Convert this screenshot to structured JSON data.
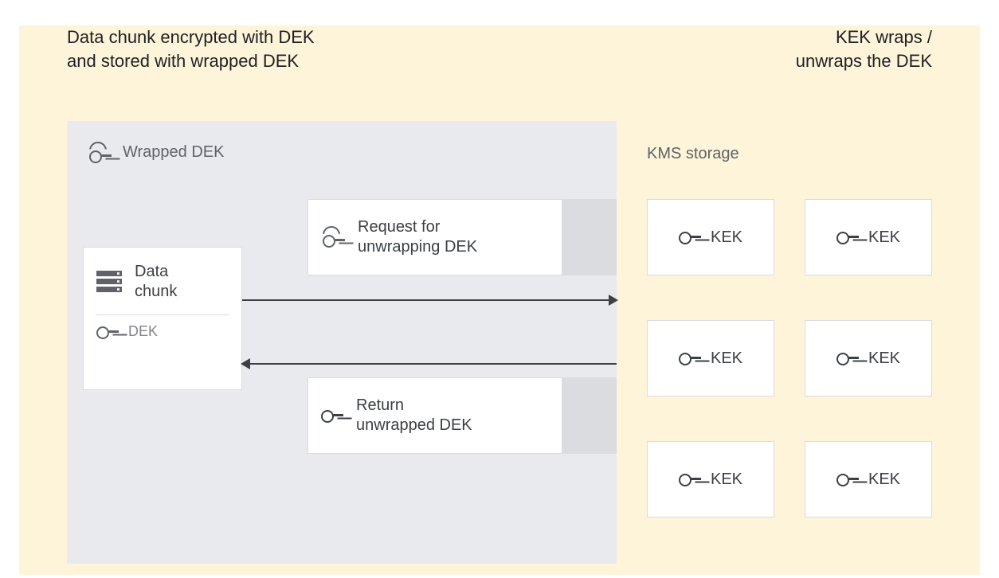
{
  "header": {
    "left_line1": "Data chunk encrypted with DEK",
    "left_line2": "and stored with wrapped DEK",
    "right_line1": "KEK wraps /",
    "right_line2": "unwraps the DEK"
  },
  "left_panel": {
    "title": "Wrapped DEK",
    "data_chunk_label": "Data\nchunk",
    "dek_label": "DEK"
  },
  "messages": {
    "request": "Request for\nunwrapping DEK",
    "return": "Return\nunwrapped DEK"
  },
  "kms": {
    "title": "KMS storage",
    "kek_label": "KEK"
  },
  "icons": {
    "wrapped_key": "wrapped-key-icon",
    "key": "key-icon",
    "storage": "storage-icon"
  }
}
